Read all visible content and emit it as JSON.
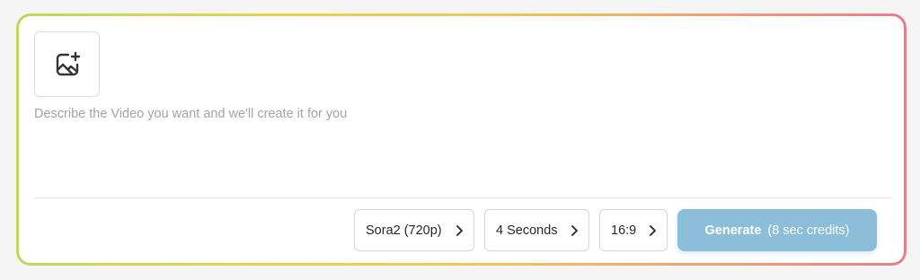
{
  "prompt": {
    "placeholder": "Describe the Video you want and we'll create it for you",
    "value": ""
  },
  "upload": {
    "icon": "image-plus-icon"
  },
  "options": {
    "model": "Sora2 (720p)",
    "duration": "4 Seconds",
    "aspect_ratio": "16:9"
  },
  "generate": {
    "label": "Generate",
    "credits": "(8 sec credits)"
  },
  "colors": {
    "generate_bg": "#8dbed9",
    "gradient": [
      "#c3d65f",
      "#e7d34e",
      "#f0c458",
      "#ee9f76",
      "#e47f8d"
    ]
  }
}
